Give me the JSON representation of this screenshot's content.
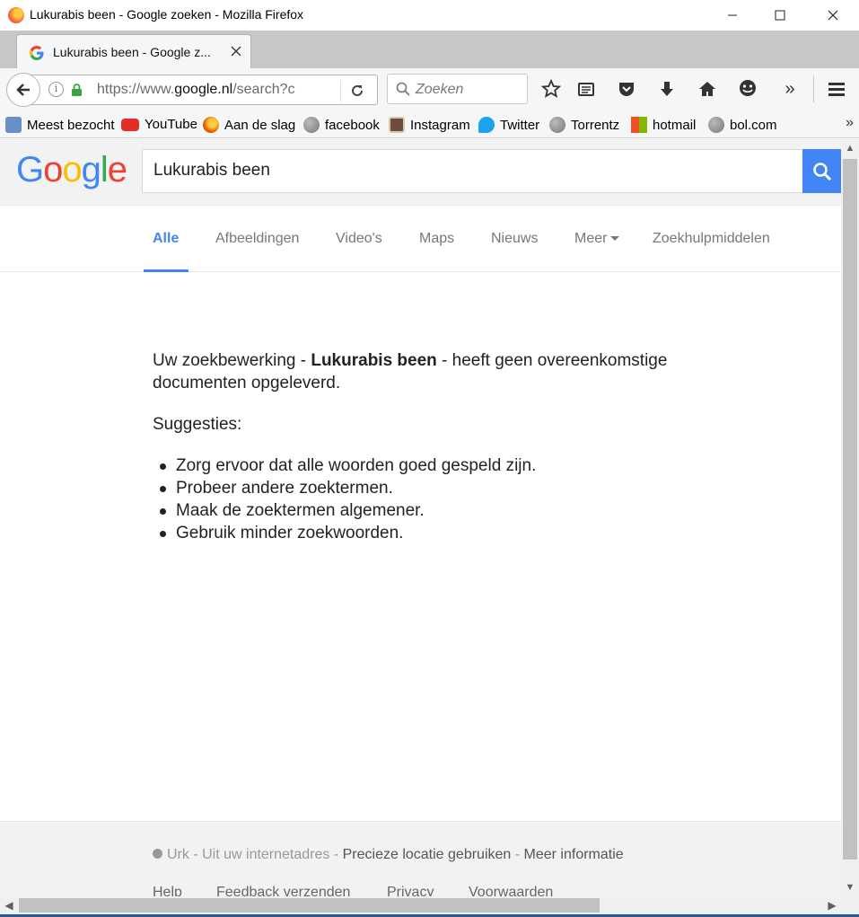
{
  "window": {
    "title": "Lukurabis been - Google zoeken - Mozilla Firefox",
    "minimize": "—",
    "maximize": "☐",
    "close": "✕"
  },
  "tab": {
    "title": "Lukurabis been - Google z...",
    "close": "✕",
    "new_tab": "+"
  },
  "nav": {
    "url_host_prefix": "https://www.",
    "url_host": "google.nl",
    "url_path": "/search?c",
    "search_placeholder": "Zoeken",
    "icons": [
      "back-icon",
      "info-icon",
      "lock-icon",
      "reload-icon",
      "search-icon",
      "star-icon",
      "reading-list-icon",
      "pocket-icon",
      "download-icon",
      "home-icon",
      "emoji-icon",
      "overflow-icon",
      "hamburger-menu-icon"
    ],
    "overflow": "»"
  },
  "bookmarks": [
    {
      "label": "Meest bezocht",
      "icon": "most-visited-icon",
      "color": "#6a8fc7"
    },
    {
      "label": "YouTube",
      "icon": "youtube-icon",
      "color": "#e52d27"
    },
    {
      "label": "Aan de slag",
      "icon": "firefox-icon",
      "color": "#e66000"
    },
    {
      "label": "facebook",
      "icon": "globe-icon",
      "color": "#8a8a8a"
    },
    {
      "label": "Instagram",
      "icon": "instagram-icon",
      "color": "#6b4e3d"
    },
    {
      "label": "Twitter",
      "icon": "twitter-icon",
      "color": "#1da1f2"
    },
    {
      "label": "Torrentz",
      "icon": "globe-icon",
      "color": "#8a8a8a"
    },
    {
      "label": "hotmail",
      "icon": "microsoft-icon",
      "color": "#f25022"
    },
    {
      "label": "bol.com",
      "icon": "globe-icon",
      "color": "#8a8a8a"
    }
  ],
  "bookmarks_more": "»",
  "google": {
    "logo_letters": [
      "G",
      "o",
      "o",
      "g",
      "l",
      "e"
    ],
    "query": "Lukurabis been",
    "tabs": [
      "Alle",
      "Afbeeldingen",
      "Video's",
      "Maps",
      "Nieuws",
      "Meer",
      "Zoekhulpmiddelen"
    ],
    "active_tab": "Alle",
    "accent": "#4285f4",
    "result_intro": "Uw zoekbewerking - ",
    "result_query": "Lukurabis been",
    "result_outro": " - heeft geen overeenkomstige documenten opgeleverd.",
    "suggestions_title": "Suggesties:",
    "suggestions": [
      "Zorg ervoor dat alle woorden goed gespeld zijn.",
      "Probeer andere zoektermen.",
      "Maak de zoektermen algemener.",
      "Gebruik minder zoekwoorden."
    ],
    "footer": {
      "location": "Urk",
      "location_source": " - Uit uw internetadres - ",
      "use_precise": "Precieze locatie gebruiken",
      "sep": " - ",
      "more_info": "Meer informatie",
      "links": [
        "Help",
        "Feedback verzenden",
        "Privacy",
        "Voorwaarden"
      ]
    }
  },
  "scrollbars": {
    "up": "▲",
    "down": "▼",
    "left": "◀",
    "right": "▶"
  }
}
